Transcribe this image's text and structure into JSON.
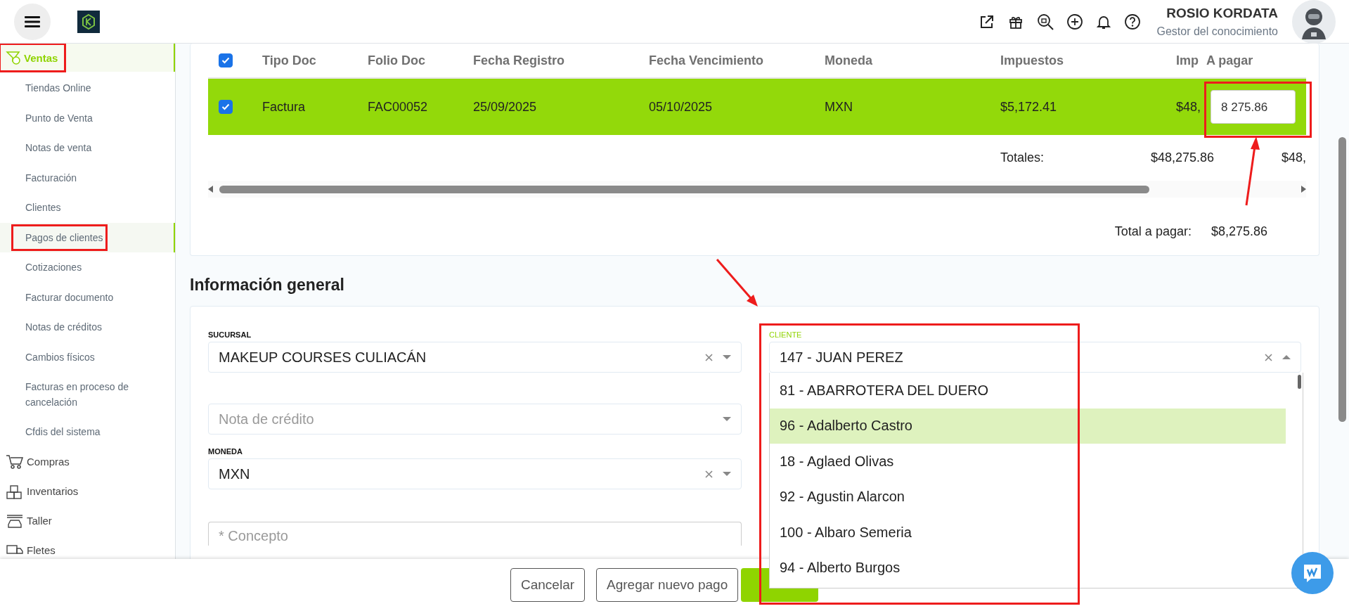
{
  "header": {
    "user_name": "ROSIO KORDATA",
    "user_role": "Gestor del conocimiento"
  },
  "sidebar": {
    "items": [
      {
        "label": "Ventas",
        "expanded": true,
        "annotated": true,
        "children": [
          {
            "label": "Tiendas Online",
            "selected": false
          },
          {
            "label": "Punto de Venta",
            "selected": false
          },
          {
            "label": "Notas de venta",
            "selected": false
          },
          {
            "label": "Facturación",
            "selected": false
          },
          {
            "label": "Clientes",
            "selected": false
          },
          {
            "label": "Pagos de clientes",
            "selected": true,
            "annotated": true
          },
          {
            "label": "Cotizaciones",
            "selected": false
          },
          {
            "label": "Facturar documento",
            "selected": false
          },
          {
            "label": "Notas de créditos",
            "selected": false
          },
          {
            "label": "Cambios físicos",
            "selected": false
          },
          {
            "label": "Facturas en proceso de cancelación",
            "selected": false
          },
          {
            "label": "Cfdis del sistema",
            "selected": false
          }
        ]
      },
      {
        "label": "Compras",
        "expanded": false
      },
      {
        "label": "Inventarios",
        "expanded": false
      },
      {
        "label": "Taller",
        "expanded": false
      },
      {
        "label": "Fletes",
        "expanded": false
      }
    ]
  },
  "payments_table": {
    "all_checked": true,
    "columns": [
      "Tipo Doc",
      "Folio Doc",
      "Fecha Registro",
      "Fecha Vencimiento",
      "Moneda",
      "Impuestos",
      "Imp",
      "A pagar"
    ],
    "rows": [
      {
        "checked": true,
        "selected": true,
        "cells": [
          "Factura",
          "FAC00052",
          "25/09/2025",
          "05/10/2025",
          "MXN",
          "$5,172.41",
          "$48,"
        ],
        "amount_to_pay": "8 275.86",
        "annotated": true
      }
    ],
    "totals": {
      "label": "Totales:",
      "values": [
        "$48,275.86",
        "$48,"
      ]
    },
    "total_to_pay": {
      "label": "Total a pagar:",
      "value": "$8,275.86"
    }
  },
  "section_title": "Información general",
  "form": {
    "sucursal": {
      "label": "SUCURSAL",
      "value": "MAKEUP COURSES CULIACÁN",
      "clearable": true
    },
    "nota_credito": {
      "placeholder": "Nota de crédito"
    },
    "moneda": {
      "label": "MONEDA",
      "value": "MXN",
      "clearable": true
    },
    "concepto": {
      "placeholder": "* Concepto"
    },
    "cliente": {
      "label": "CLIENTE",
      "value": "147 - JUAN PEREZ",
      "clearable": true,
      "open": true,
      "annotated": true,
      "options": [
        {
          "label": "81 - ABARROTERA DEL DUERO",
          "selected": false
        },
        {
          "label": "96 - Adalberto Castro",
          "selected": true
        },
        {
          "label": "18 - Aglaed Olivas",
          "selected": false
        },
        {
          "label": "92 - Agustin Alarcon",
          "selected": false
        },
        {
          "label": "100 - Albaro Semeria",
          "selected": false
        },
        {
          "label": "94 - Alberto Burgos",
          "selected": false
        }
      ]
    }
  },
  "footer_buttons": [
    {
      "kind": "outline",
      "label": "Cancelar"
    },
    {
      "kind": "outline",
      "label": "Agregar nuevo pago"
    },
    {
      "kind": "primary"
    }
  ]
}
